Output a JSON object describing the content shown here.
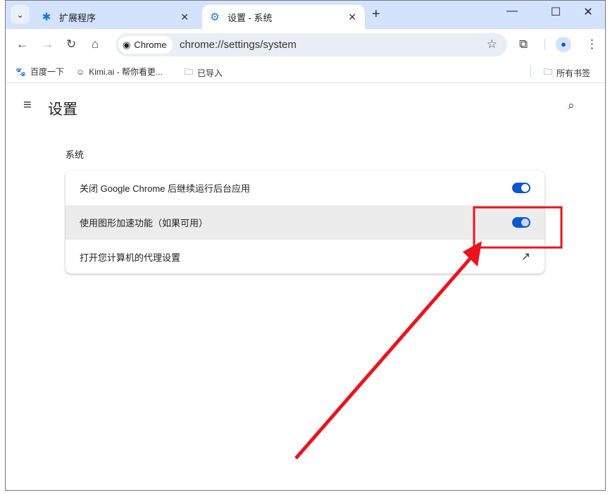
{
  "tabs": [
    {
      "label": "扩展程序",
      "icon": "puzzle-icon"
    },
    {
      "label": "设置 - 系统",
      "icon": "gear-icon"
    }
  ],
  "omnibox": {
    "chip": "Chrome",
    "url": "chrome://settings/system"
  },
  "bookmarks": [
    {
      "label": "百度一下"
    },
    {
      "label": "Kimi.ai - 帮你看更..."
    },
    {
      "label": "已导入"
    }
  ],
  "all_bookmarks": "所有书签",
  "settings": {
    "title": "设置",
    "section": "系统",
    "rows": [
      {
        "label": "关闭 Google Chrome 后继续运行后台应用",
        "type": "toggle",
        "on": true
      },
      {
        "label": "使用图形加速功能（如果可用）",
        "type": "toggle",
        "on": true
      },
      {
        "label": "打开您计算机的代理设置",
        "type": "external-link"
      }
    ]
  },
  "annotation_color": "#e8141e"
}
